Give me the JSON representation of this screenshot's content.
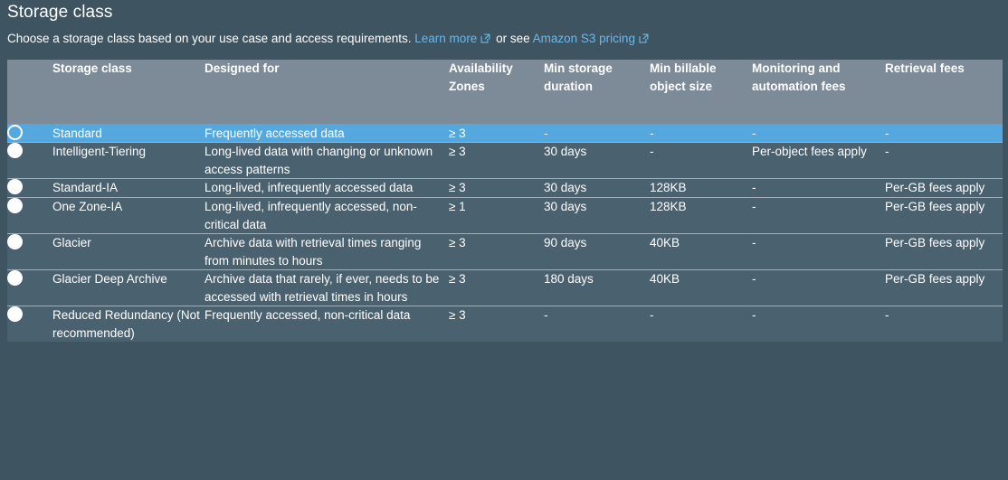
{
  "section": {
    "title": "Storage class",
    "description_prefix": "Choose a storage class based on your use case and access requirements.",
    "link_learn_more": "Learn more",
    "between_links": "or see",
    "link_pricing": "Amazon S3 pricing"
  },
  "colors": {
    "page_background": "#3f5461",
    "table_header": "#7d8b98",
    "table_row": "#4a6170",
    "selected_row": "#55a8dd",
    "link": "#6cb8e8",
    "row_divider": "#9fb0ba",
    "text": "#ffffff"
  },
  "table": {
    "columns": [
      "Storage class",
      "Designed for",
      "Availability Zones",
      "Min storage duration",
      "Min billable object size",
      "Monitoring and automation fees",
      "Retrieval fees"
    ],
    "rows": [
      {
        "selected": true,
        "name": "Standard",
        "designed_for": "Frequently accessed data",
        "availability_zones": "≥ 3",
        "min_storage_duration": "-",
        "min_billable_object_size": "-",
        "monitoring_and_automation_fees": "-",
        "retrieval_fees": "-"
      },
      {
        "selected": false,
        "name": "Intelligent-Tiering",
        "designed_for": "Long-lived data with changing or unknown access patterns",
        "availability_zones": "≥ 3",
        "min_storage_duration": "30 days",
        "min_billable_object_size": "-",
        "monitoring_and_automation_fees": "Per-object fees apply",
        "retrieval_fees": "-"
      },
      {
        "selected": false,
        "name": "Standard-IA",
        "designed_for": "Long-lived, infrequently accessed data",
        "availability_zones": "≥ 3",
        "min_storage_duration": "30 days",
        "min_billable_object_size": "128KB",
        "monitoring_and_automation_fees": "-",
        "retrieval_fees": "Per-GB fees apply"
      },
      {
        "selected": false,
        "name": "One Zone-IA",
        "designed_for": "Long-lived, infrequently accessed, non-critical data",
        "availability_zones": "≥ 1",
        "min_storage_duration": "30 days",
        "min_billable_object_size": "128KB",
        "monitoring_and_automation_fees": "-",
        "retrieval_fees": "Per-GB fees apply"
      },
      {
        "selected": false,
        "name": "Glacier",
        "designed_for": "Archive data with retrieval times ranging from minutes to hours",
        "availability_zones": "≥ 3",
        "min_storage_duration": "90 days",
        "min_billable_object_size": "40KB",
        "monitoring_and_automation_fees": "-",
        "retrieval_fees": "Per-GB fees apply"
      },
      {
        "selected": false,
        "name": "Glacier Deep Archive",
        "designed_for": "Archive data that rarely, if ever, needs to be accessed with retrieval times in hours",
        "availability_zones": "≥ 3",
        "min_storage_duration": "180 days",
        "min_billable_object_size": "40KB",
        "monitoring_and_automation_fees": "-",
        "retrieval_fees": "Per-GB fees apply"
      },
      {
        "selected": false,
        "name": "Reduced Redundancy (Not recommended)",
        "designed_for": "Frequently accessed, non-critical data",
        "availability_zones": "≥ 3",
        "min_storage_duration": "-",
        "min_billable_object_size": "-",
        "monitoring_and_automation_fees": "-",
        "retrieval_fees": "-"
      }
    ]
  }
}
